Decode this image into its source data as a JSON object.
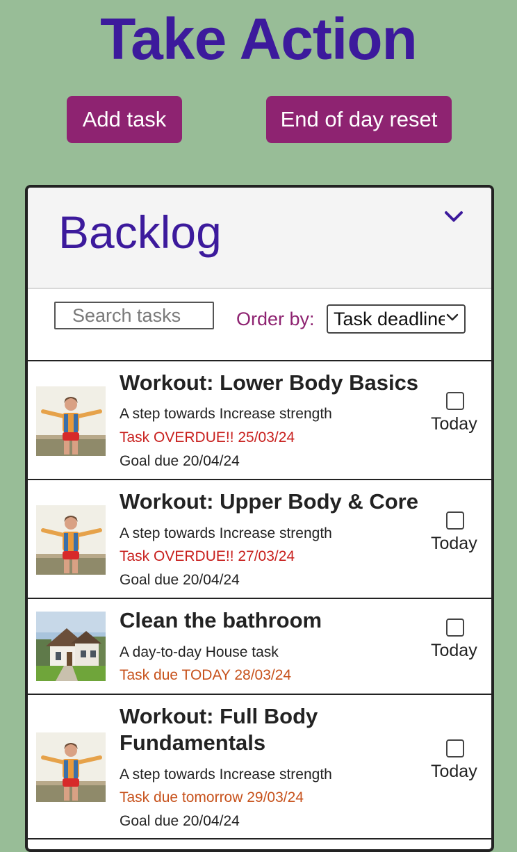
{
  "header": {
    "title": "Take Action",
    "add_task_label": "Add task",
    "reset_label": "End of day reset"
  },
  "backlog": {
    "title": "Backlog",
    "search_placeholder": "Search tasks",
    "order_label": "Order by:",
    "order_selected": "Task deadline"
  },
  "tasks": [
    {
      "title": "Workout: Lower Body Basics",
      "subtitle": "A step towards Increase strength",
      "status": "Task OVERDUE!! 25/03/24",
      "goal": "Goal due 20/04/24",
      "today_label": "Today",
      "image": "person-outdoors-arms-outstretched"
    },
    {
      "title": "Workout: Upper Body & Core",
      "subtitle": "A step towards Increase strength",
      "status": "Task OVERDUE!! 27/03/24",
      "goal": "Goal due 20/04/24",
      "today_label": "Today",
      "image": "person-outdoors-arms-outstretched"
    },
    {
      "title": "Clean the bathroom",
      "subtitle": "A day-to-day House task",
      "status": "Task due TODAY 28/03/24",
      "today_label": "Today",
      "image": "house-exterior"
    },
    {
      "title": "Workout: Full Body Fundamentals",
      "subtitle": "A step towards Increase strength",
      "status": "Task due tomorrow 29/03/24",
      "goal": "Goal due 20/04/24",
      "today_label": "Today",
      "image": "person-outdoors-arms-outstretched"
    }
  ],
  "colors": {
    "background": "#98bd97",
    "title": "#3c1a9c",
    "button": "#8e2371",
    "overdue": "#c8201e",
    "due_soon": "#c7521c"
  }
}
